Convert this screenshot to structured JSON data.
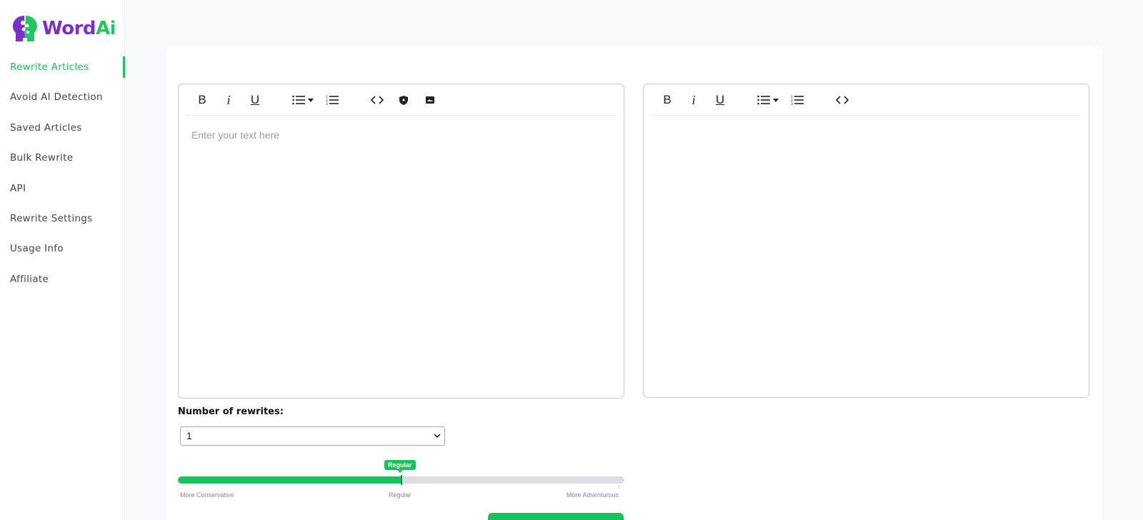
{
  "brand": {
    "name_part1": "Word",
    "name_part2": "Ai"
  },
  "sidebar": {
    "items": [
      {
        "label": "Rewrite Articles",
        "active": true
      },
      {
        "label": "Avoid AI Detection"
      },
      {
        "label": "Saved Articles"
      },
      {
        "label": "Bulk Rewrite"
      },
      {
        "label": "API"
      },
      {
        "label": "Rewrite Settings"
      },
      {
        "label": "Usage Info"
      },
      {
        "label": "Affiliate"
      }
    ]
  },
  "input_editor": {
    "placeholder": "Enter your text here",
    "toolbar": {
      "bold": "B",
      "italic": "i",
      "underline": "U"
    }
  },
  "output_editor": {
    "toolbar": {
      "bold": "B",
      "italic": "i",
      "underline": "U"
    }
  },
  "rewrites": {
    "label": "Number of rewrites:",
    "selected": "1"
  },
  "creativity_slider": {
    "value_label": "Regular",
    "value_fraction": 0.5,
    "ticks": [
      "More Conservative",
      "Regular",
      "More Adventurous"
    ]
  },
  "colors": {
    "accent": "#14c45a",
    "brand_purple": "#7a2fc9"
  }
}
